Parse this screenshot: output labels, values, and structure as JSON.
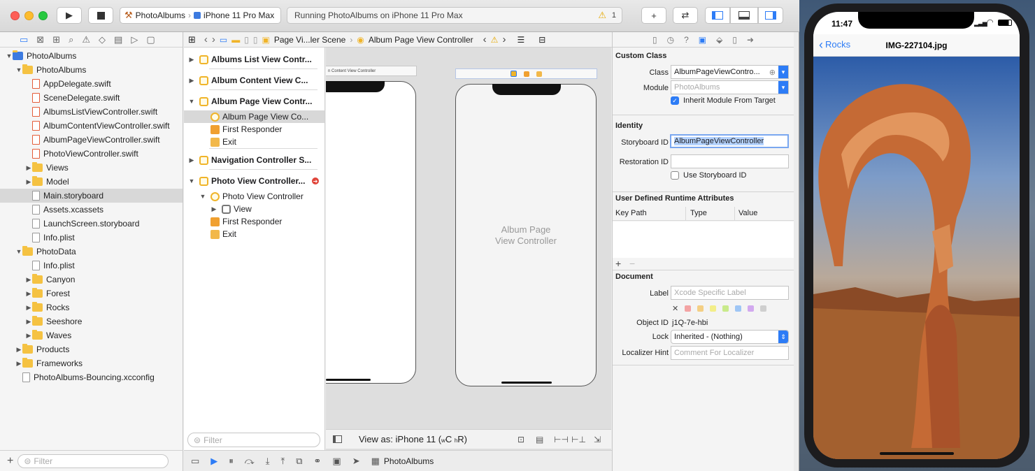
{
  "toolbar": {
    "scheme_app": "PhotoAlbums",
    "scheme_device": "iPhone 11 Pro Max",
    "activity_text": "Running PhotoAlbums on iPhone 11 Pro Max",
    "warning_count": "1",
    "plus": "+"
  },
  "navigator": {
    "tree": [
      {
        "label": "PhotoAlbums",
        "kind": "project",
        "indent": 0,
        "disclosure": "▼"
      },
      {
        "label": "PhotoAlbums",
        "kind": "folder",
        "indent": 1,
        "disclosure": "▼"
      },
      {
        "label": "AppDelegate.swift",
        "kind": "swift",
        "indent": 2,
        "disclosure": ""
      },
      {
        "label": "SceneDelegate.swift",
        "kind": "swift",
        "indent": 2,
        "disclosure": ""
      },
      {
        "label": "AlbumsListViewController.swift",
        "kind": "swift",
        "indent": 2,
        "disclosure": ""
      },
      {
        "label": "AlbumContentViewController.swift",
        "kind": "swift",
        "indent": 2,
        "disclosure": ""
      },
      {
        "label": "AlbumPageViewController.swift",
        "kind": "swift",
        "indent": 2,
        "disclosure": ""
      },
      {
        "label": "PhotoViewController.swift",
        "kind": "swift",
        "indent": 2,
        "disclosure": ""
      },
      {
        "label": "Views",
        "kind": "folder",
        "indent": 2,
        "disclosure": "▶"
      },
      {
        "label": "Model",
        "kind": "folder",
        "indent": 2,
        "disclosure": "▶"
      },
      {
        "label": "Main.storyboard",
        "kind": "storyboard",
        "indent": 2,
        "disclosure": "",
        "selected": true
      },
      {
        "label": "Assets.xcassets",
        "kind": "assets",
        "indent": 2,
        "disclosure": ""
      },
      {
        "label": "LaunchScreen.storyboard",
        "kind": "storyboard",
        "indent": 2,
        "disclosure": ""
      },
      {
        "label": "Info.plist",
        "kind": "plist",
        "indent": 2,
        "disclosure": ""
      },
      {
        "label": "PhotoData",
        "kind": "folder",
        "indent": 1,
        "disclosure": "▼"
      },
      {
        "label": "Info.plist",
        "kind": "plist",
        "indent": 2,
        "disclosure": ""
      },
      {
        "label": "Canyon",
        "kind": "folder",
        "indent": 2,
        "disclosure": "▶"
      },
      {
        "label": "Forest",
        "kind": "folder",
        "indent": 2,
        "disclosure": "▶"
      },
      {
        "label": "Rocks",
        "kind": "folder",
        "indent": 2,
        "disclosure": "▶"
      },
      {
        "label": "Seeshore",
        "kind": "folder",
        "indent": 2,
        "disclosure": "▶"
      },
      {
        "label": "Waves",
        "kind": "folder",
        "indent": 2,
        "disclosure": "▶"
      },
      {
        "label": "Products",
        "kind": "folder",
        "indent": 1,
        "disclosure": "▶"
      },
      {
        "label": "Frameworks",
        "kind": "folder",
        "indent": 1,
        "disclosure": "▶"
      },
      {
        "label": "PhotoAlbums-Bouncing.xcconfig",
        "kind": "config",
        "indent": 1,
        "disclosure": ""
      }
    ],
    "filter_placeholder": "Filter"
  },
  "jumpbar": {
    "crumb1": "Page Vi...ler Scene",
    "crumb2": "Album Page View Controller"
  },
  "outline": {
    "items": [
      {
        "label": "Albums List View Contr...",
        "bold": true,
        "disclosure": "▶",
        "indent": 0,
        "icon": "scene"
      },
      {
        "label": "Album Content View C...",
        "bold": true,
        "disclosure": "▶",
        "indent": 0,
        "icon": "scene"
      },
      {
        "label": "Album Page View Contr...",
        "bold": true,
        "disclosure": "▼",
        "indent": 0,
        "icon": "scene"
      },
      {
        "label": "Album Page View Co...",
        "bold": false,
        "disclosure": "",
        "indent": 1,
        "icon": "vc",
        "selected": true
      },
      {
        "label": "First Responder",
        "bold": false,
        "disclosure": "",
        "indent": 1,
        "icon": "responder"
      },
      {
        "label": "Exit",
        "bold": false,
        "disclosure": "",
        "indent": 1,
        "icon": "exit"
      },
      {
        "label": "Navigation Controller S...",
        "bold": true,
        "disclosure": "▶",
        "indent": 0,
        "icon": "scene"
      },
      {
        "label": "Photo View Controller...",
        "bold": true,
        "disclosure": "▼",
        "indent": 0,
        "icon": "scene",
        "error": true
      },
      {
        "label": "Photo View Controller",
        "bold": false,
        "disclosure": "▼",
        "indent": 1,
        "icon": "vc"
      },
      {
        "label": "View",
        "bold": false,
        "disclosure": "▶",
        "indent": 2,
        "icon": "view"
      },
      {
        "label": "First Responder",
        "bold": false,
        "disclosure": "",
        "indent": 1,
        "icon": "responder"
      },
      {
        "label": "Exit",
        "bold": false,
        "disclosure": "",
        "indent": 1,
        "icon": "exit"
      }
    ],
    "filter_placeholder": "Filter"
  },
  "canvas": {
    "left_scene_title": "n Content View Controller",
    "right_scene_label_line1": "Album Page",
    "right_scene_label_line2": "View Controller"
  },
  "viewas": {
    "text": "View as: iPhone 11 (",
    "w": "w",
    "c": "C",
    "h": "h",
    "r": "R)"
  },
  "bottombar": {
    "target": "PhotoAlbums"
  },
  "inspector": {
    "custom_class": {
      "header": "Custom Class",
      "class_label": "Class",
      "class_value": "AlbumPageViewContro...",
      "module_label": "Module",
      "module_placeholder": "PhotoAlbums",
      "inherit_label": "Inherit Module From Target",
      "inherit_checked": true
    },
    "identity": {
      "header": "Identity",
      "storyboard_id_label": "Storyboard ID",
      "storyboard_id_value": "AlbumPageViewController",
      "restoration_id_label": "Restoration ID",
      "restoration_id_value": "",
      "use_storyboard_label": "Use Storyboard ID"
    },
    "runtime": {
      "header": "User Defined Runtime Attributes",
      "col_keypath": "Key Path",
      "col_type": "Type",
      "col_value": "Value",
      "plus": "+",
      "minus": "−"
    },
    "document": {
      "header": "Document",
      "label_label": "Label",
      "label_placeholder": "Xcode Specific Label",
      "object_id_label": "Object ID",
      "object_id_value": "j1Q-7e-hbi",
      "lock_label": "Lock",
      "lock_value": "Inherited - (Nothing)",
      "localizer_label": "Localizer Hint",
      "localizer_placeholder": "Comment For Localizer",
      "color_swatches": [
        "#f3a3a3",
        "#f4cf84",
        "#f3ee89",
        "#c9ea8b",
        "#9fc6f5",
        "#d2a9ef",
        "#cfcfcf"
      ]
    }
  },
  "simulator": {
    "time": "11:47",
    "back_label": "Rocks",
    "title": "IMG-227104.jpg"
  }
}
